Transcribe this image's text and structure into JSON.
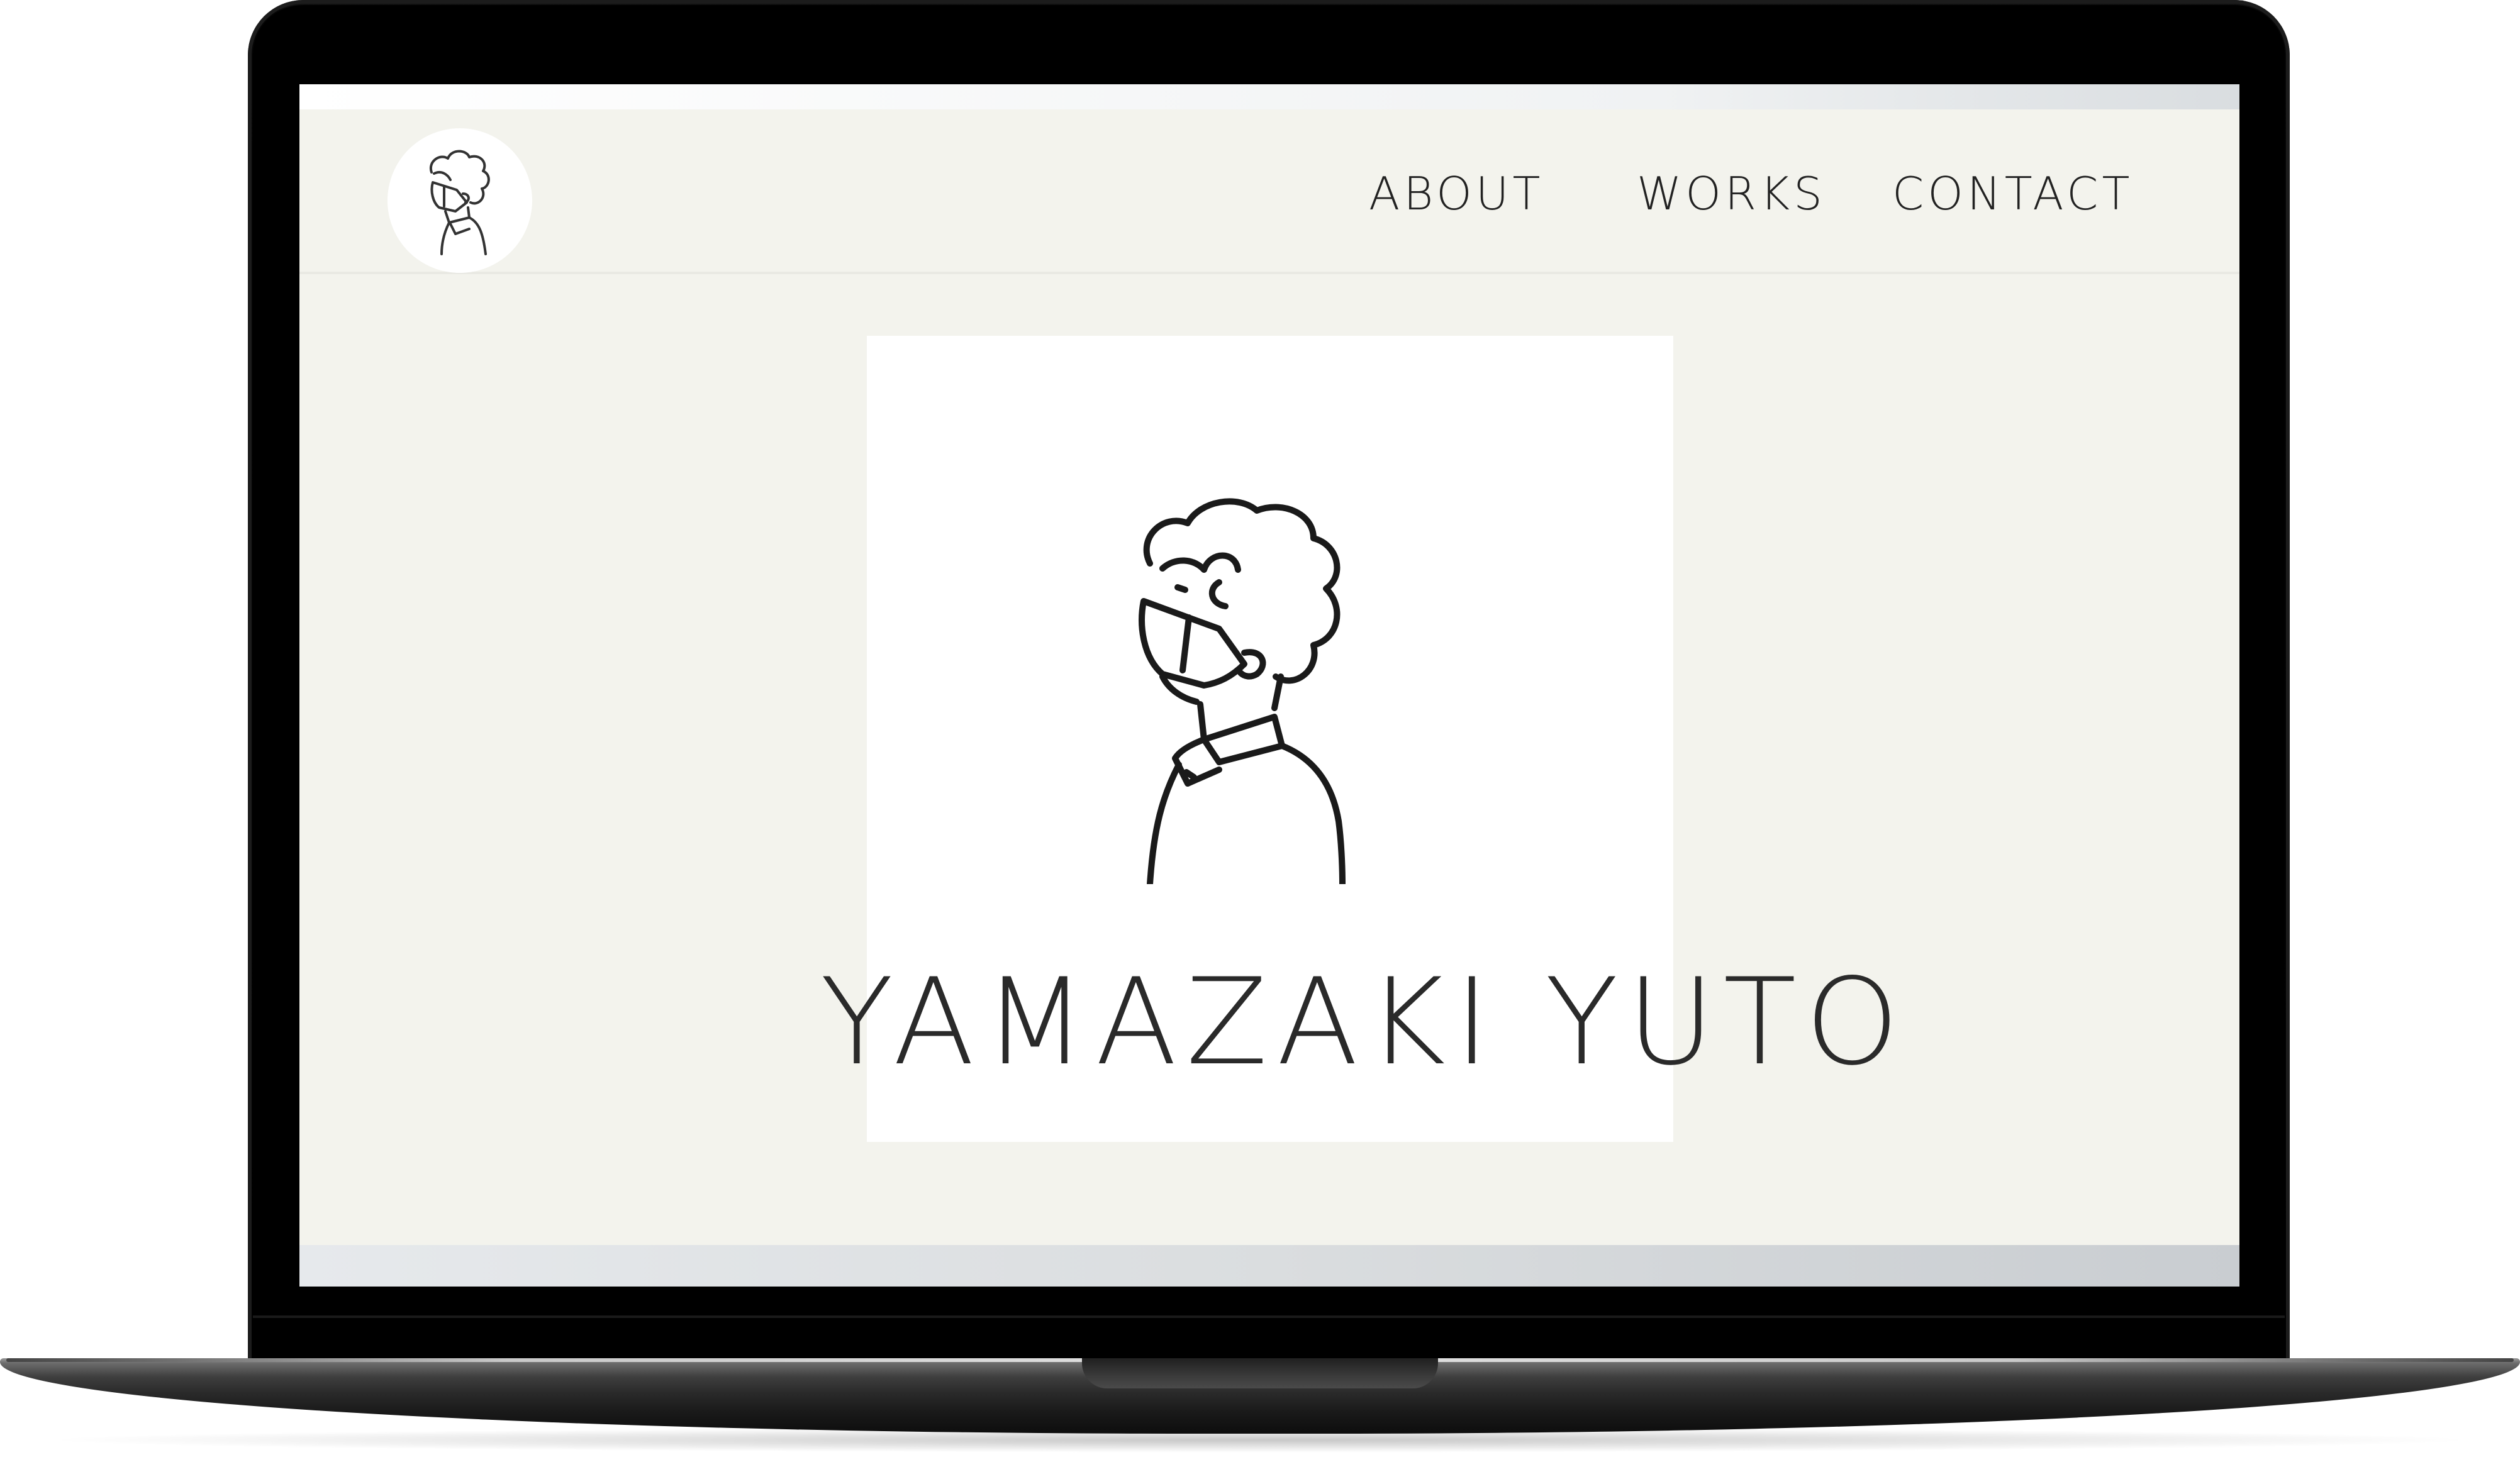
{
  "nav": {
    "about": "ABOUT",
    "works": "WORKS",
    "contact": "CONTACT"
  },
  "hero": {
    "title": "YAMAZAKI YUTO"
  },
  "logo": {
    "icon": "avatar-illustration-icon"
  },
  "colors": {
    "page_background": "#f3f3ed",
    "card_background": "#ffffff",
    "text": "#2a2a2a",
    "laptop_bezel": "#000000"
  }
}
